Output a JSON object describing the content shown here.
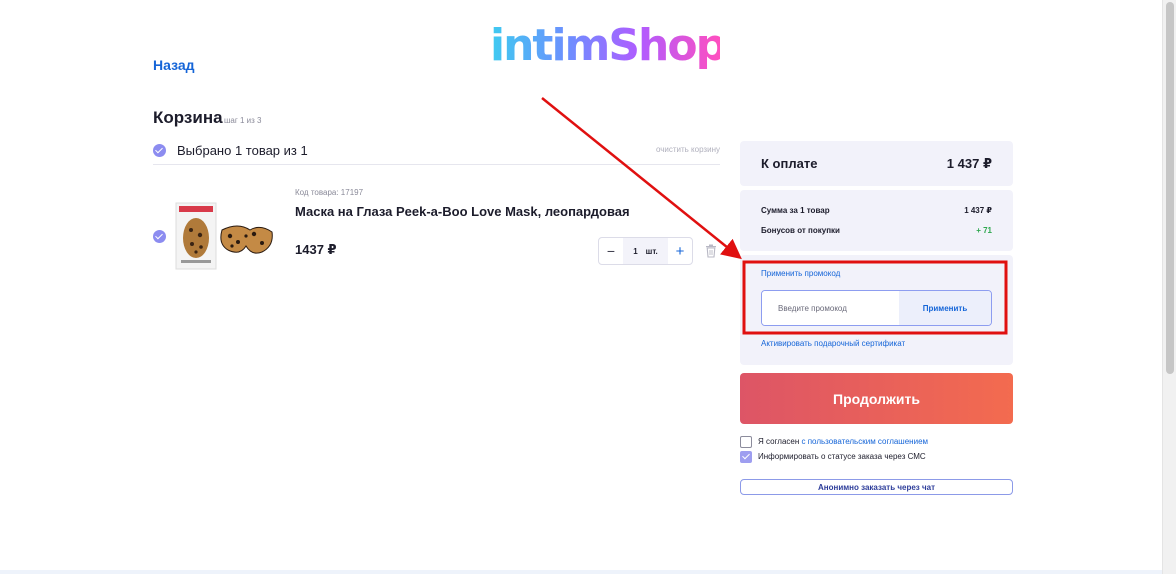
{
  "header": {
    "logo_text": "intimShop.ru",
    "back_label": "Назад"
  },
  "cart": {
    "title": "Корзина",
    "step": "шаг 1 из 3",
    "selected_label": "Выбрано 1 товар из 1",
    "clear_label": "очистить корзину",
    "item": {
      "code": "Код товара: 17197",
      "name": "Маска на Глаза Peek-a-Boo Love Mask, леопардовая",
      "price": "1437 ₽",
      "quantity": "1",
      "unit": "шт."
    },
    "qty_minus": "−",
    "qty_plus": "+"
  },
  "summary": {
    "pay_label": "К оплате",
    "pay_total": "1 437 ₽",
    "sum_label": "Сумма за 1 товар",
    "sum_value": "1 437 ₽",
    "bonus_label": "Бонусов от покупки",
    "bonus_value": "+ 71"
  },
  "promo": {
    "link_label": "Применить промокод",
    "input_placeholder": "Введите промокод",
    "input_value": "",
    "apply_label": "Применить",
    "gift_label": "Активировать подарочный сертификат"
  },
  "actions": {
    "continue_label": "Продолжить",
    "agree_text": "Я согласен ",
    "agree_link": "с пользовательским соглашением",
    "agree_checked": false,
    "sms_text": "Информировать о статусе заказа через СМС",
    "sms_checked": true,
    "anon_label": "Анонимно заказать через чат"
  },
  "colors": {
    "accent_blue": "#1565d8",
    "check_purple": "#8c8cf0",
    "panel_bg": "#f2f2fa",
    "continue_gradient_start": "#dd5566",
    "continue_gradient_end": "#f36b4f",
    "bonus_green": "#2fa84f",
    "annotation_red": "#e01010"
  }
}
